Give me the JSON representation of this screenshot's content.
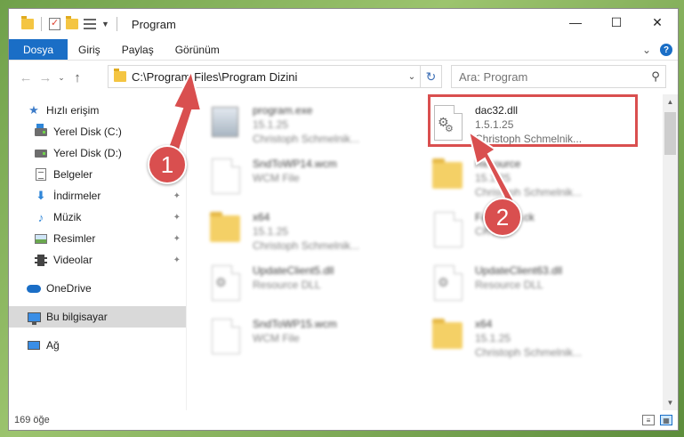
{
  "window": {
    "title": "Program",
    "controls": {
      "minimize": "—",
      "maximize": "☐",
      "close": "✕"
    }
  },
  "ribbon": {
    "tabs": [
      {
        "label": "Dosya"
      },
      {
        "label": "Giriş"
      },
      {
        "label": "Paylaş"
      },
      {
        "label": "Görünüm"
      }
    ],
    "expand_glyph": "⌄",
    "help_glyph": "?"
  },
  "navigation": {
    "back_glyph": "←",
    "forward_glyph": "→",
    "recent_glyph": "⌄",
    "up_glyph": "↑",
    "address_path": "C:\\Program Files\\Program Dizini",
    "address_dropdown_glyph": "⌄",
    "refresh_glyph": "↻",
    "search_placeholder": "Ara: Program",
    "search_glyph": "⚲"
  },
  "sidebar": {
    "quick_access": {
      "label": "Hızlı erişim",
      "items": [
        {
          "label": "Yerel Disk (C:)",
          "icon": "windows-drive-icon",
          "pinned": false
        },
        {
          "label": "Yerel Disk (D:)",
          "icon": "drive-icon",
          "pinned": false
        },
        {
          "label": "Belgeler",
          "icon": "documents-icon",
          "pinned": false
        },
        {
          "label": "İndirmeler",
          "icon": "downloads-icon",
          "pinned": true
        },
        {
          "label": "Müzik",
          "icon": "music-icon",
          "pinned": true
        },
        {
          "label": "Resimler",
          "icon": "pictures-icon",
          "pinned": true
        },
        {
          "label": "Videolar",
          "icon": "videos-icon",
          "pinned": true
        }
      ]
    },
    "onedrive": {
      "label": "OneDrive"
    },
    "this_pc": {
      "label": "Bu bilgisayar"
    },
    "network": {
      "label": "Ağ"
    },
    "pin_glyph": "📌"
  },
  "files": [
    {
      "name": "program.exe",
      "line2": "15.1.25",
      "line3": "Christoph Schmelnik...",
      "icon": "exe-icon",
      "blurred": true
    },
    {
      "name": "dac32.dll",
      "line2": "1.5.1.25",
      "line3": "Christoph Schmelnik...",
      "icon": "dll-gear-icon",
      "blurred": false,
      "highlighted": true
    },
    {
      "name": "SndToWP14.wcm",
      "line2": "WCM File",
      "line3": "",
      "icon": "document-icon",
      "blurred": true
    },
    {
      "name": "Resource",
      "line2": "15.1.25",
      "line3": "Christoph Schmelnik...",
      "icon": "folder-icon",
      "blurred": true
    },
    {
      "name": "x64",
      "line2": "15.1.25",
      "line3": "Christoph Schmelnik...",
      "icon": "folder-icon",
      "blurred": true
    },
    {
      "name": "FaxSetup.ck",
      "line2": "CK File",
      "line3": "",
      "icon": "document-icon",
      "blurred": true
    },
    {
      "name": "UpdateClient5.dll",
      "line2": "Resource DLL",
      "line3": "",
      "icon": "dll-icon",
      "blurred": true
    },
    {
      "name": "UpdateClient63.dll",
      "line2": "Resource DLL",
      "line3": "",
      "icon": "dll-icon",
      "blurred": true
    },
    {
      "name": "SndToWP15.wcm",
      "line2": "WCM File",
      "line3": "",
      "icon": "document-icon",
      "blurred": true
    },
    {
      "name": "x64",
      "line2": "15.1.25",
      "line3": "Christoph Schmelnik...",
      "icon": "folder-icon",
      "blurred": true
    }
  ],
  "annotations": [
    {
      "number": "1",
      "points_to": "address-bar"
    },
    {
      "number": "2",
      "points_to": "dac32.dll"
    }
  ],
  "status": {
    "item_count": "169 öğe"
  },
  "colors": {
    "accent": "#1a6ec6",
    "annotation_red": "#d94f4f",
    "selection": "#d9d9d9"
  }
}
